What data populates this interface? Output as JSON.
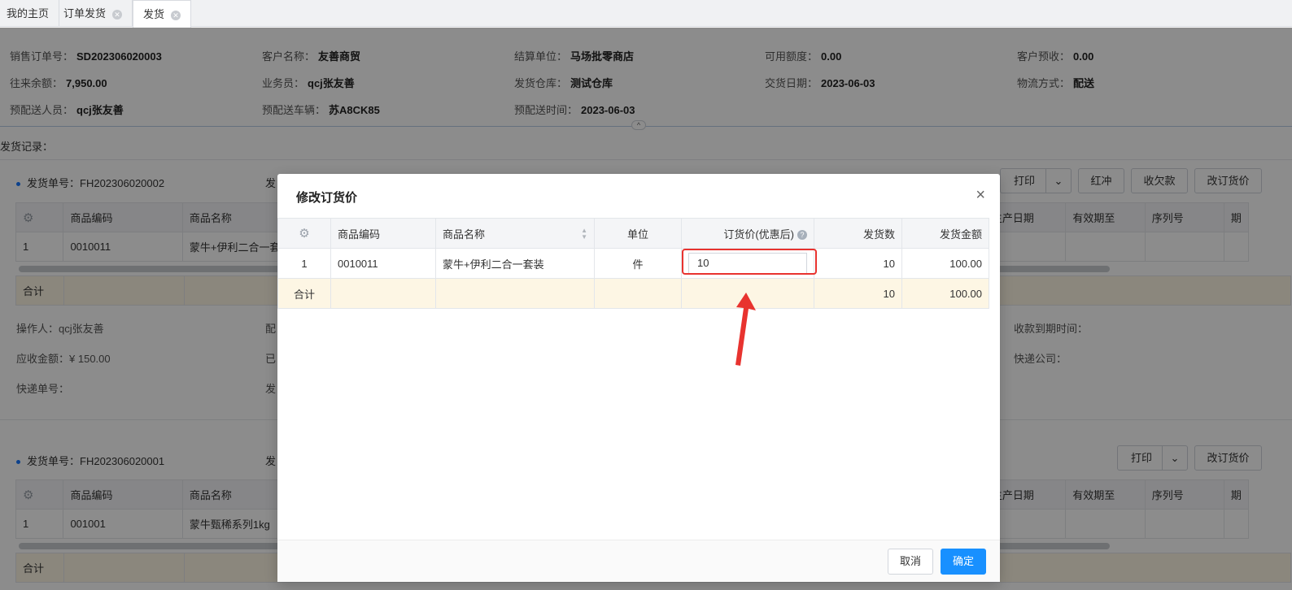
{
  "tabs": [
    {
      "label": "我的主页",
      "closable": false
    },
    {
      "label": "订单发货",
      "closable": true
    },
    {
      "label": "发货",
      "closable": true,
      "active": true
    }
  ],
  "order_info": {
    "row1": [
      {
        "label": "销售订单号：",
        "value": "SD202306020003"
      },
      {
        "label": "客户名称：",
        "value": "友善商贸"
      },
      {
        "label": "结算单位：",
        "value": "马场批零商店"
      },
      {
        "label": "可用额度：",
        "value": "0.00"
      },
      {
        "label": "客户预收：",
        "value": "0.00"
      }
    ],
    "row2": [
      {
        "label": "往来余额：",
        "value": "7,950.00"
      },
      {
        "label": "业务员：",
        "value": "qcj张友善"
      },
      {
        "label": "发货仓库：",
        "value": "测试仓库"
      },
      {
        "label": "交货日期：",
        "value": "2023-06-03"
      },
      {
        "label": "物流方式：",
        "value": "配送"
      }
    ],
    "row3": [
      {
        "label": "预配送人员：",
        "value": "qcj张友善"
      },
      {
        "label": "预配送车辆：",
        "value": "苏A8CK85"
      },
      {
        "label": "预配送时间：",
        "value": "2023-06-03"
      }
    ]
  },
  "records_label": "发货记录：",
  "records": [
    {
      "title_label": "发货单号：",
      "number": "FH202306020002",
      "extra_prefix": "发",
      "buttons": [
        "打印",
        "红冲",
        "收欠款",
        "改订货价"
      ],
      "columns_left": [
        "商品编码",
        "商品名称"
      ],
      "columns_right": [
        "生产日期",
        "有效期至",
        "序列号",
        "期"
      ],
      "row": {
        "idx": "1",
        "code": "0010011",
        "name": "蒙牛+伊利二合一套"
      },
      "sum_label": "合计",
      "meta": {
        "operator_label": "操作人：",
        "operator": "qcj张友善",
        "operator_trail": "配",
        "receivable_label": "应收金额：",
        "receivable": "¥ 150.00",
        "receivable_trail": "已",
        "tracking_label": "快递单号：",
        "tracking_trail": "发",
        "due_label": "收款到期时间：",
        "courier_label": "快递公司："
      }
    },
    {
      "title_label": "发货单号：",
      "number": "FH202306020001",
      "extra_prefix": "发",
      "buttons": [
        "打印",
        "改订货价"
      ],
      "columns_left": [
        "商品编码",
        "商品名称"
      ],
      "columns_right": [
        "生产日期",
        "有效期至",
        "序列号",
        "期"
      ],
      "row": {
        "idx": "1",
        "code": "001001",
        "name": "蒙牛甄稀系列1kg"
      },
      "sum_label": "合计"
    }
  ],
  "modal": {
    "title": "修改订货价",
    "close_glyph": "×",
    "columns": [
      "商品编码",
      "商品名称",
      "单位",
      "订货价(优惠后)",
      "发货数",
      "发货金额"
    ],
    "help_glyph": "?",
    "row": {
      "idx": "1",
      "code": "0010011",
      "name": "蒙牛+伊利二合一套装",
      "unit": "件",
      "price": "10",
      "qty": "10",
      "amount": "100.00"
    },
    "sum": {
      "label": "合计",
      "qty": "10",
      "amount": "100.00"
    },
    "cancel": "取消",
    "confirm": "确定"
  },
  "colors": {
    "accent": "#1890ff",
    "highlight": "#e8332f"
  }
}
